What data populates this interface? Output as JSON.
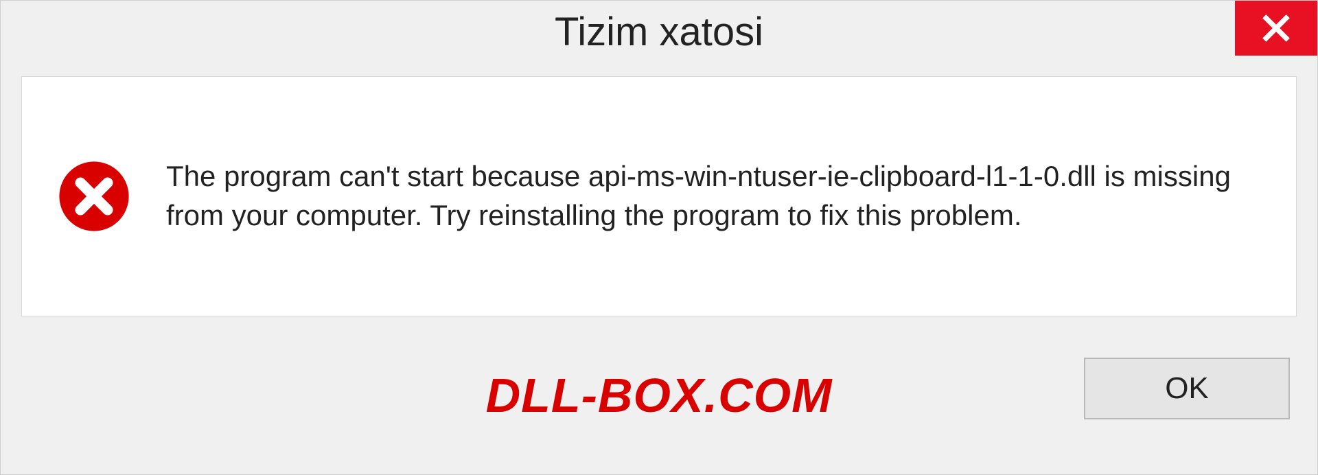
{
  "dialog": {
    "title": "Tizim xatosi",
    "message": "The program can't start because api-ms-win-ntuser-ie-clipboard-l1-1-0.dll is missing from your computer. Try reinstalling the program to fix this problem.",
    "ok_label": "OK"
  },
  "watermark": "DLL-BOX.COM",
  "colors": {
    "close_bg": "#e81123",
    "error_icon": "#d90000",
    "watermark": "#d90000"
  }
}
